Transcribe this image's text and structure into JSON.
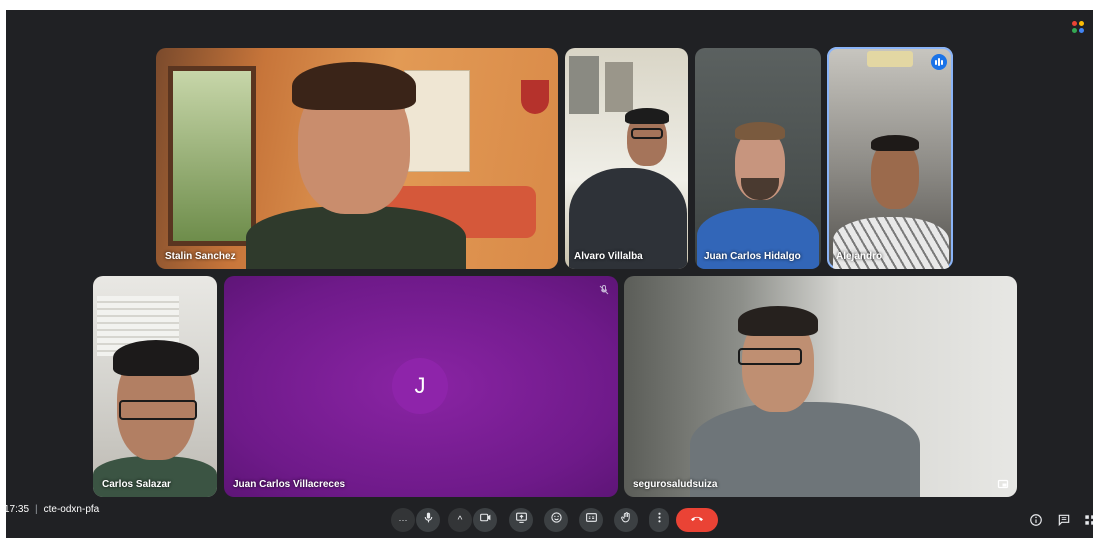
{
  "meeting": {
    "time": "17:35",
    "separator": "|",
    "code": "cte-odxn-pfa"
  },
  "participants": [
    {
      "name": "Stalin Sanchez"
    },
    {
      "name": "Alvaro Villalba"
    },
    {
      "name": "Juan Carlos Hidalgo"
    },
    {
      "name": "Alejandro",
      "speaking": true
    },
    {
      "name": "Carlos Salazar"
    },
    {
      "name": "Juan Carlos Villacreces",
      "avatar_letter": "J",
      "muted": true
    },
    {
      "name": "segurosaludsuiza"
    }
  ],
  "controls": {
    "more_label": "···",
    "chevron_label": "^",
    "icons": [
      "mic-icon",
      "camera-icon",
      "present-icon",
      "emoji-icon",
      "captions-icon",
      "raise-hand-icon",
      "more-vert-icon",
      "end-call-icon"
    ]
  },
  "right_icons": [
    "info-icon",
    "chat-icon",
    "activities-icon"
  ],
  "colors": {
    "background": "#202124",
    "end_call": "#ea4335",
    "avatar_tile": "#7b1fa2",
    "avatar_circle": "#8e24aa",
    "speaking_border": "#8ab4f8"
  }
}
